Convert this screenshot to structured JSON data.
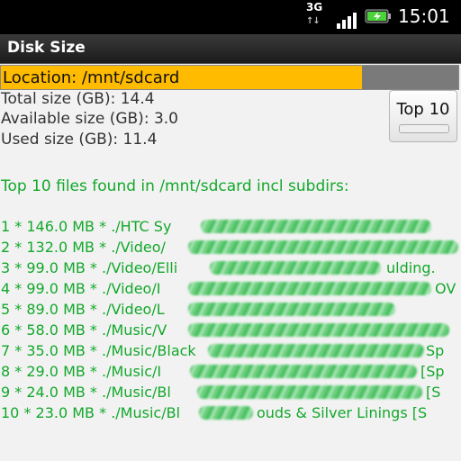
{
  "status_bar": {
    "network_type": "3G",
    "time": "15:01",
    "icons": [
      "signal-icon",
      "battery-charging-icon"
    ]
  },
  "app": {
    "title": "Disk Size"
  },
  "location": {
    "label": "Location: /mnt/sdcard",
    "used_fraction": 0.79
  },
  "sizes": {
    "total": "Total size (GB): 14.4",
    "available": "Available size (GB): 3.0",
    "used": "Used size (GB): 11.4"
  },
  "top10_button": {
    "label": "Top 10"
  },
  "results_header": "Top 10 files found in /mnt/sdcard incl subdirs:",
  "files": [
    {
      "text": "1 * 146.0 MB * ./HTC Sy",
      "tail": ""
    },
    {
      "text": "2 * 132.0 MB * ./Video/",
      "tail": ""
    },
    {
      "text": "3 * 99.0 MB * ./Video/Elli",
      "tail": "ulding."
    },
    {
      "text": "4 * 99.0 MB * ./Video/I",
      "tail": "OV"
    },
    {
      "text": "5 * 89.0 MB * ./Video/L",
      "tail": ""
    },
    {
      "text": "6 * 58.0 MB * ./Music/V",
      "tail": ""
    },
    {
      "text": "7 * 35.0 MB * ./Music/Black",
      "tail": "Sp"
    },
    {
      "text": "8 * 29.0 MB * ./Music/I",
      "tail": "[Sp"
    },
    {
      "text": "9 * 24.0 MB * ./Music/Bl",
      "tail": "[S"
    },
    {
      "text": "10 * 23.0 MB * ./Music/Bl",
      "tail": "ouds & Silver Linings [S"
    }
  ],
  "colors": {
    "accent": "#ffbb00",
    "result_text": "#13a82b"
  }
}
